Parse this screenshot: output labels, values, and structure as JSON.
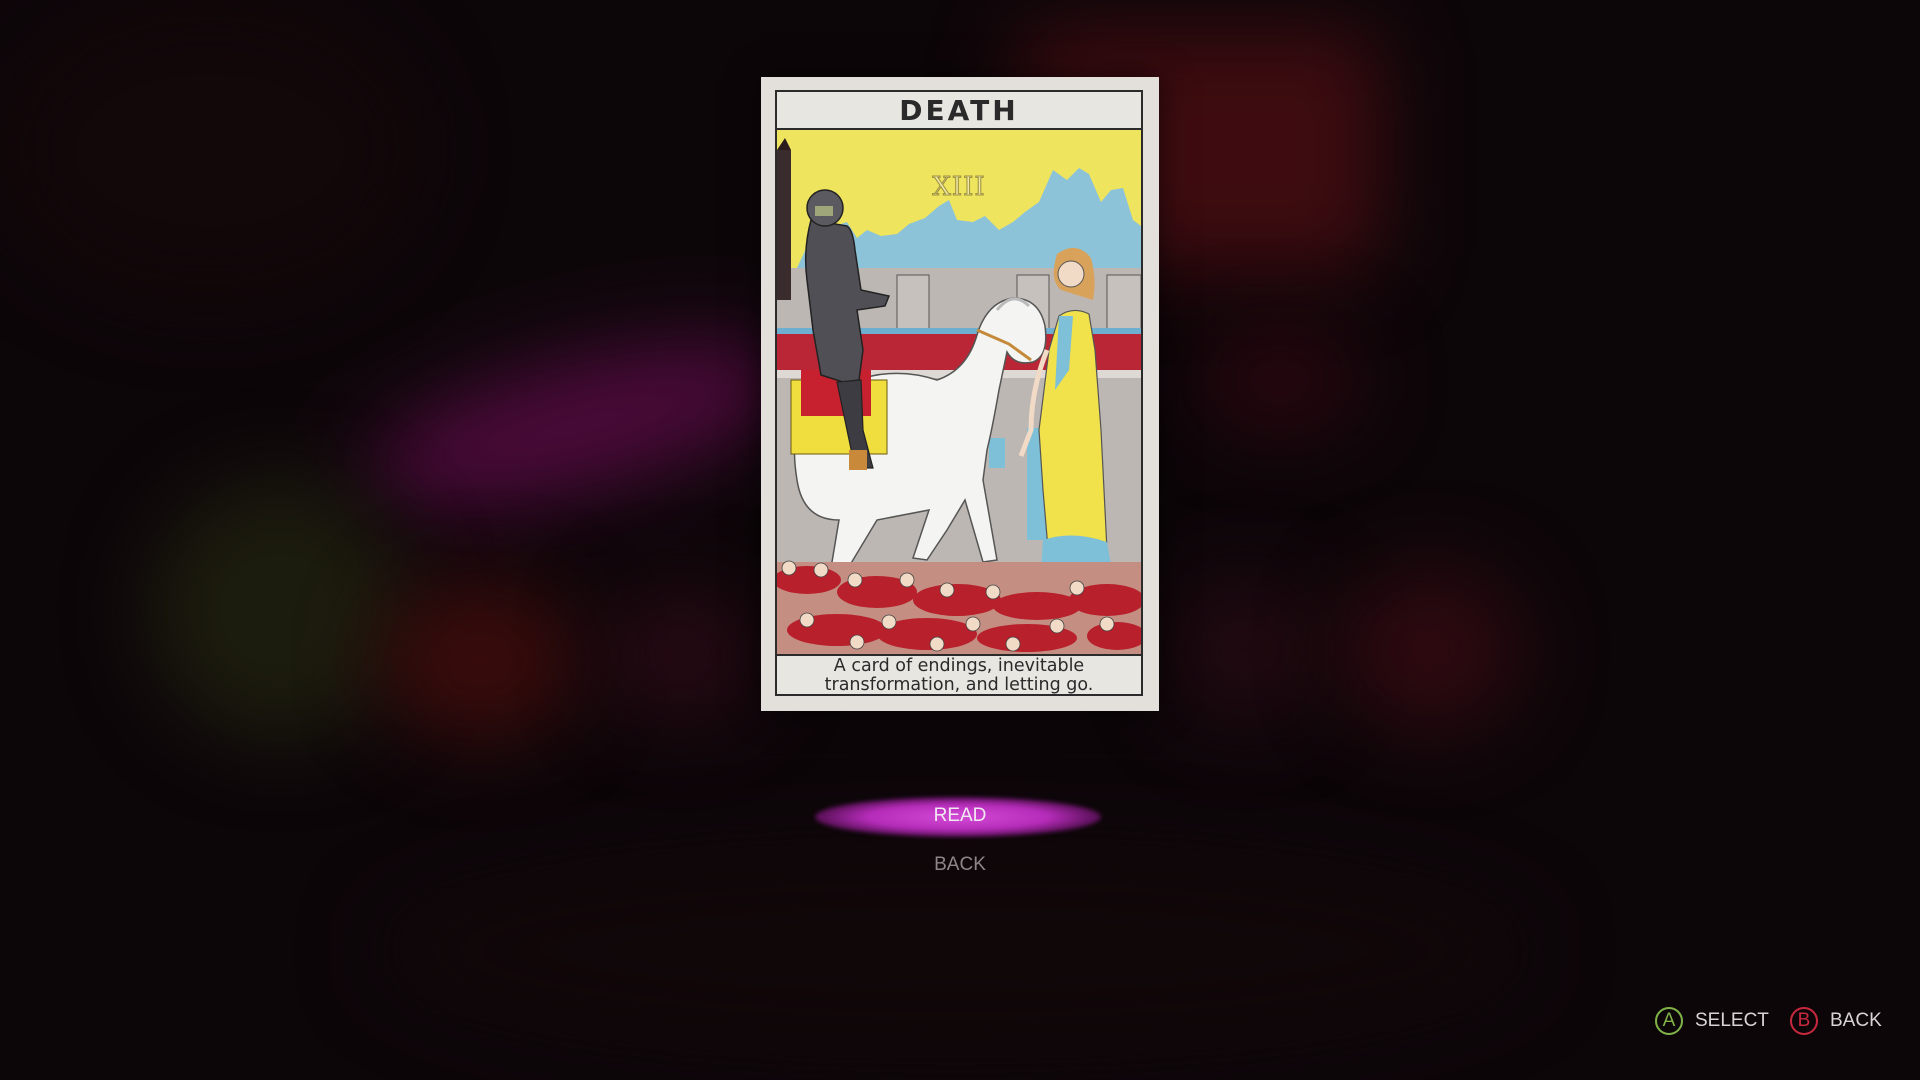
{
  "card": {
    "title": "DEATH",
    "numeral": "XIII",
    "caption_line1": "A card of endings, inevitable",
    "caption_line2": "transformation, and letting go."
  },
  "menu": {
    "items": [
      {
        "label": "READ",
        "selected": true
      },
      {
        "label": "BACK",
        "selected": false
      }
    ],
    "highlight_color": "#c93fcd"
  },
  "hints": [
    {
      "button": "A",
      "label": "SELECT",
      "color": "#7fb347"
    },
    {
      "button": "B",
      "label": "BACK",
      "color": "#c8283e"
    }
  ]
}
